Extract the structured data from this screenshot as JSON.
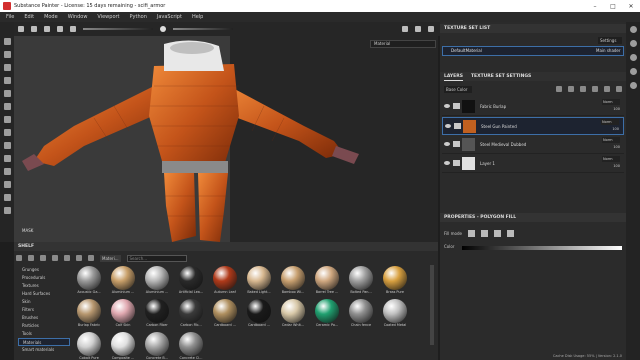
{
  "window": {
    "title": "Substance Painter - License: 15 days remaining - scifi_armor"
  },
  "menu": [
    "File",
    "Edit",
    "Mode",
    "Window",
    "Viewport",
    "Python",
    "JavaScript",
    "Help"
  ],
  "viewport": {
    "material_mode": "Material",
    "label": "MASK"
  },
  "texture_set_list": {
    "title": "TEXTURE SET LIST",
    "settings_label": "Settings",
    "item": "DefaultMaterial",
    "shader": "Main shader"
  },
  "layers_panel": {
    "tabs": [
      "LAYERS",
      "TEXTURE SET SETTINGS"
    ],
    "channel": "Base Color",
    "layers": [
      {
        "name": "Fabric Burlap",
        "blend": "Norm",
        "opacity": "100",
        "thumb_color": "#111111",
        "selected": false
      },
      {
        "name": "Steel Gun Painted",
        "blend": "Norm",
        "opacity": "100",
        "thumb_color": "#c06020",
        "selected": true
      },
      {
        "name": "Steel Medieval Dubbed",
        "blend": "Norm",
        "opacity": "100",
        "thumb_color": "#555555",
        "selected": false
      },
      {
        "name": "Layer 1",
        "blend": "Norm",
        "opacity": "100",
        "thumb_color": "#e0e0e0",
        "selected": false
      }
    ]
  },
  "properties": {
    "title": "PROPERTIES - POLYGON FILL",
    "fill_mode_label": "Fill mode",
    "color_label": "Color"
  },
  "shelf": {
    "title": "SHELF",
    "search_tag": "Materi...",
    "search_placeholder": "Search...",
    "categories": [
      "Grunges",
      "Procedurals",
      "Textures",
      "Hard Surfaces",
      "Skin",
      "Filters",
      "Brushes",
      "Particles",
      "Tools",
      "Materials",
      "Smart materials"
    ],
    "selected_category": "Materials",
    "materials": [
      {
        "name": "Acoustic Ga...",
        "color": "#9a9a9a"
      },
      {
        "name": "Aluminium ...",
        "color": "#c9a06a"
      },
      {
        "name": "Aluminium ...",
        "color": "#b8b8b8"
      },
      {
        "name": "Artificial Lea...",
        "color": "#2a2a2a"
      },
      {
        "name": "Autumn Leaf",
        "color": "#b03a1a"
      },
      {
        "name": "Baked Light...",
        "color": "#d8b890"
      },
      {
        "name": "Bamboo Wi...",
        "color": "#c8a070"
      },
      {
        "name": "Barrel Tree ...",
        "color": "#d0a880"
      },
      {
        "name": "Bolted Pan...",
        "color": "#a0a0a0"
      },
      {
        "name": "Brass Pure",
        "color": "#d8a040"
      },
      {
        "name": "Burlap Fabric",
        "color": "#b89870"
      },
      {
        "name": "Calf Skin",
        "color": "#e0a8b0"
      },
      {
        "name": "Carbon Fiber",
        "color": "#202020"
      },
      {
        "name": "Carbon Fib...",
        "color": "#3a3a3a"
      },
      {
        "name": "Cardboard ...",
        "color": "#b09060"
      },
      {
        "name": "Cardboard ...",
        "color": "#1a1a1a"
      },
      {
        "name": "Cedar Whit...",
        "color": "#d8c8a8"
      },
      {
        "name": "Ceramic Po...",
        "color": "#20a070"
      },
      {
        "name": "Chain fence",
        "color": "#909090"
      },
      {
        "name": "Coated Metal",
        "color": "#c0c0c0"
      },
      {
        "name": "Cobalt Pure",
        "color": "#d0d0d0"
      },
      {
        "name": "Composite ...",
        "color": "#e0e0e0"
      },
      {
        "name": "Concrete B...",
        "color": "#a8a8a8"
      },
      {
        "name": "Concrete Cl...",
        "color": "#909090"
      }
    ]
  },
  "status": {
    "text": "Cache Disk Usage: 55% | Version: 2.1.0"
  }
}
